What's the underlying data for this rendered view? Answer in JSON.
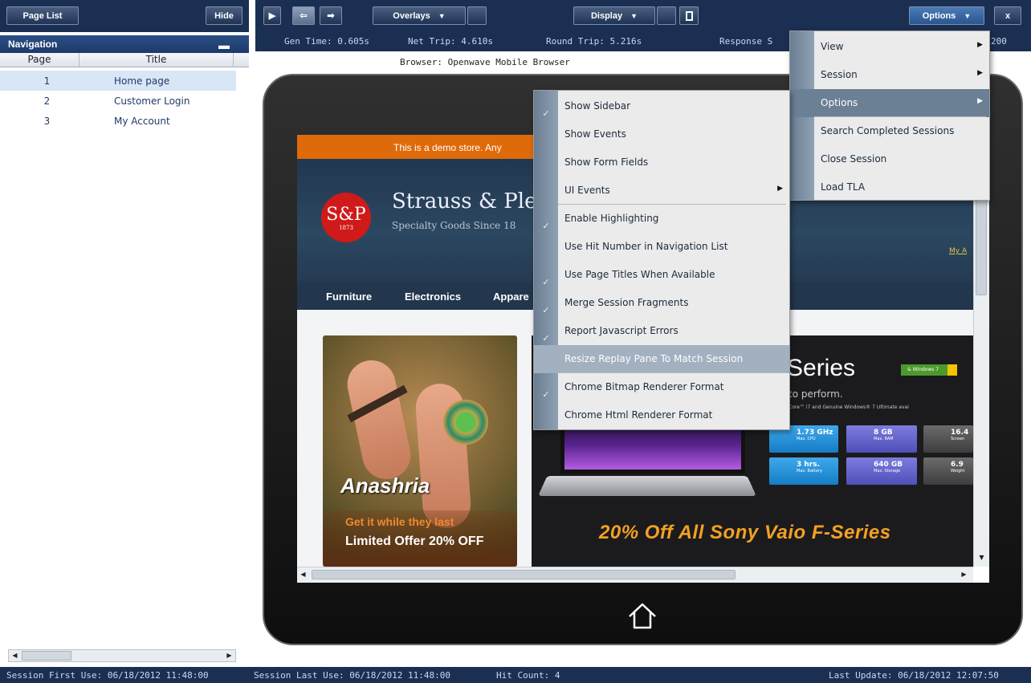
{
  "left_toolbar": {
    "page_list": "Page List",
    "hide": "Hide"
  },
  "right_toolbar": {
    "overlays": "Overlays",
    "display": "Display",
    "options": "Options",
    "close": "x"
  },
  "navigation": {
    "title": "Navigation",
    "col_page": "Page",
    "col_title": "Title",
    "rows": [
      {
        "page": "1",
        "title": "Home page",
        "selected": true
      },
      {
        "page": "2",
        "title": "Customer Login"
      },
      {
        "page": "3",
        "title": "My Account"
      }
    ]
  },
  "stats": {
    "gen_time": "Gen Time: 0.605s",
    "net_trip": "Net Trip: 4.610s",
    "round_trip": "Round Trip: 5.216s",
    "response": "Response S",
    "trailing": "200"
  },
  "browser_label": "Browser: Openwave Mobile Browser",
  "site": {
    "banner": "This is a demo store. Any",
    "logo_letters": "S&P",
    "logo_year": "1873",
    "brand": "Strauss & Ples",
    "tagline": "Specialty Goods Since 18",
    "my_account": "My A",
    "nav": [
      "Furniture",
      "Electronics",
      "Appare"
    ],
    "promo_name": "Anashria",
    "promo_cta": "Get it while they last",
    "promo_offer": "Limited Offer 20% OFF",
    "series": "Series",
    "to_perform": "to perform.",
    "core_line": "Core™ i7 and Genuine Windows® 7 Ultimate avai",
    "win_badge": "& Windows 7",
    "specs": [
      {
        "value": "1.73 GHz",
        "label": "Max. CPU"
      },
      {
        "value": "8 GB",
        "label": "Max. RAM"
      },
      {
        "value": "16.4",
        "label": "Screen"
      },
      {
        "value": "3 hrs.",
        "label": "Max. Battery"
      },
      {
        "value": "640 GB",
        "label": "Max. Storage"
      },
      {
        "value": "6.9",
        "label": "Weight"
      }
    ],
    "offer": "20% Off All Sony Vaio F-Series"
  },
  "options_menu": {
    "items": [
      "View",
      "Session",
      "Options",
      "Search Completed Sessions",
      "Close Session",
      "Load TLA"
    ]
  },
  "options_submenu": {
    "items": [
      {
        "label": "Show Sidebar",
        "checked": true
      },
      {
        "label": "Show Events",
        "checked": false
      },
      {
        "label": "Show Form Fields",
        "checked": false
      },
      {
        "label": "UI Events",
        "checked": false,
        "submenu": true
      },
      {
        "label": "Enable Highlighting",
        "checked": true
      },
      {
        "label": "Use Hit Number in Navigation List",
        "checked": false
      },
      {
        "label": "Use Page Titles When Available",
        "checked": true
      },
      {
        "label": "Merge Session Fragments",
        "checked": true
      },
      {
        "label": "Report Javascript Errors",
        "checked": true
      },
      {
        "label": "Resize Replay Pane To Match Session",
        "checked": false,
        "highlighted": true
      },
      {
        "label": "Chrome Bitmap Renderer Format",
        "checked": true
      },
      {
        "label": "Chrome Html Renderer Format",
        "checked": false
      }
    ]
  },
  "footer": {
    "first_use": "Session First Use: 06/18/2012 11:48:00",
    "last_use": "Session Last Use: 06/18/2012 11:48:00",
    "hit_count": "Hit Count: 4",
    "last_update": "Last Update: 06/18/2012 12:07:50"
  }
}
